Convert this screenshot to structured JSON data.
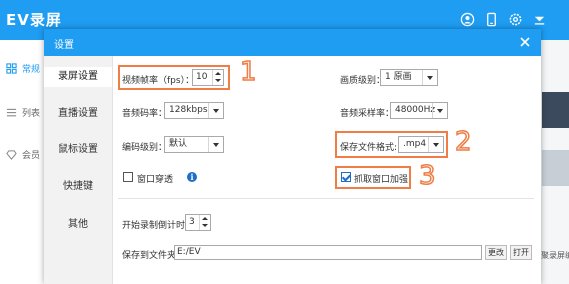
{
  "app": {
    "title": "EV录屏",
    "header_color": "#1e9df2",
    "icons": [
      "user-icon",
      "phone-icon",
      "settings-icon",
      "menu-icon"
    ]
  },
  "sidebar": {
    "items": [
      {
        "label": "常规",
        "icon": "grid-icon",
        "active": true
      },
      {
        "label": "列表",
        "icon": "list-icon",
        "active": false
      },
      {
        "label": "会员",
        "icon": "diamond-icon",
        "active": false
      }
    ]
  },
  "background_peek": {
    "text": "聚录屏编辑"
  },
  "dialog": {
    "title": "设置",
    "nav": [
      {
        "label": "录屏设置",
        "active": true
      },
      {
        "label": "直播设置",
        "active": false
      },
      {
        "label": "鼠标设置",
        "active": false
      },
      {
        "label": "快捷键",
        "active": false
      },
      {
        "label": "其他",
        "active": false
      }
    ],
    "settings": {
      "fps_label": "视频帧率（fps）：",
      "fps_value": "10",
      "quality_label": "画质级别：",
      "quality_value": "1 原画",
      "audio_bitrate_label": "音频码率：",
      "audio_bitrate_value": "128kbps",
      "sample_rate_label": "音频采样率：",
      "sample_rate_value": "48000Hz",
      "encode_label": "编码级别：",
      "encode_value": "默认",
      "format_label": "保存文件格式:",
      "format_value": ".mp4",
      "window_through_label": "窗口穿透",
      "window_through_checked": false,
      "capture_boost_label": "抓取窗口加强",
      "capture_boost_checked": true,
      "countdown_label": "开始录制倒计时:",
      "countdown_value": "3",
      "save_path_label": "保存到文件夹:",
      "save_path_value": "E:/EV",
      "change_button": "更改",
      "open_button": "打开"
    },
    "annotations": {
      "color": "#ef7d45",
      "numbers": [
        "1",
        "2",
        "3"
      ]
    }
  }
}
